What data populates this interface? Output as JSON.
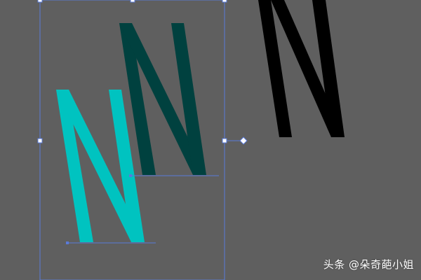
{
  "canvas": {
    "background": "#5f5f5f"
  },
  "shapes": {
    "letter_black": {
      "glyph": "N",
      "color": "#000000"
    },
    "letter_dark_teal": {
      "glyph": "N",
      "color": "#00413f"
    },
    "letter_cyan": {
      "glyph": "N",
      "color": "#00c3c0"
    }
  },
  "selection": {
    "color": "#5a7bd8",
    "handle_fill": "#ffffff"
  },
  "watermark": {
    "text": "头条 @朵奇葩小姐"
  }
}
